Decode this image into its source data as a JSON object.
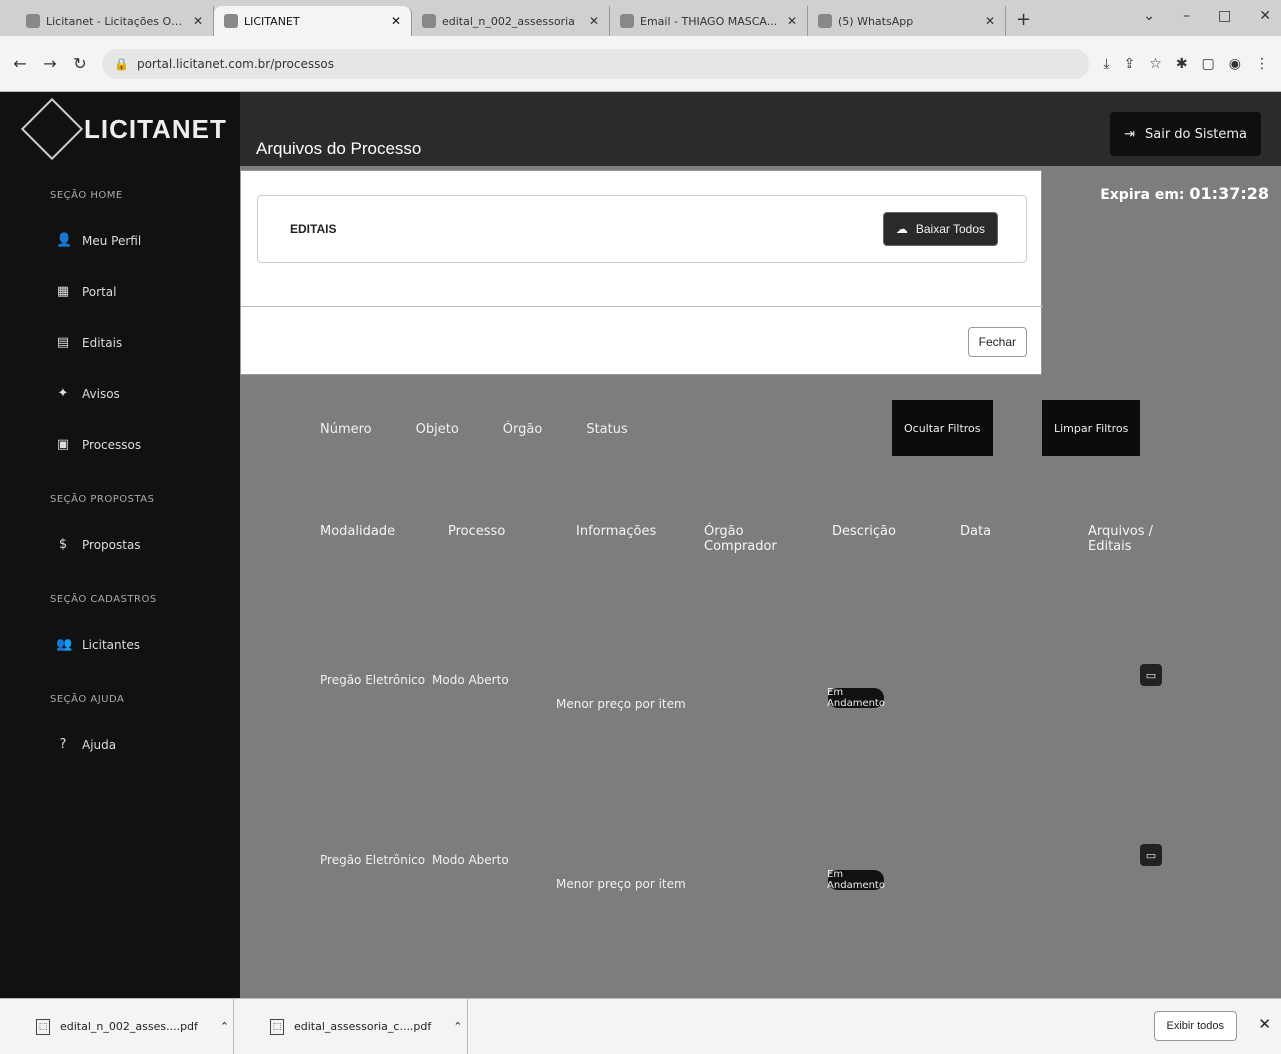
{
  "browser": {
    "tabs": [
      {
        "title": "Licitanet - Licitações On...",
        "active": false
      },
      {
        "title": "LICITANET",
        "active": true
      },
      {
        "title": "edital_n_002_assessoria",
        "active": false
      },
      {
        "title": "Email - THIAGO MASCA...",
        "active": false
      },
      {
        "title": "(5) WhatsApp",
        "active": false
      }
    ],
    "new_tab": "+",
    "url": "portal.licitanet.com.br/processos"
  },
  "sidebar": {
    "brand": "LICITANET",
    "sections": [
      {
        "title": "SEÇÃO HOME",
        "items": [
          "Meu Perfil",
          "Portal",
          "Editais",
          "Avisos",
          "Processos"
        ]
      },
      {
        "title": "SEÇÃO PROPOSTAS",
        "items": [
          "Propostas"
        ]
      },
      {
        "title": "SEÇÃO CADASTROS",
        "items": [
          "Licitantes"
        ]
      },
      {
        "title": "SEÇÃO AJUDA",
        "items": [
          "Ajuda"
        ]
      }
    ]
  },
  "header": {
    "exit_label": "Sair do Sistema",
    "timer_label": "Expira em:",
    "timer_value": "01:37:28"
  },
  "backdrop": {
    "filters": [
      "Número",
      "Objeto",
      "Órgão",
      "Status"
    ],
    "buttons": [
      "Ocultar Filtros",
      "Limpar Filtros"
    ],
    "columns": [
      "Modalidade",
      "Processo",
      "Informações",
      "Órgão Comprador",
      "Descrição",
      "Data",
      "Arquivos / Editais"
    ],
    "rows": [
      {
        "modalidade": "Pregão Eletrônico",
        "processo": "Modo Aberto",
        "info": "Menor preço por item",
        "status": "Em Andamento"
      },
      {
        "modalidade": "Pregão Eletrônico",
        "processo": "Modo Aberto",
        "info": "Menor preço por item",
        "status": "Em Andamento"
      }
    ]
  },
  "modal": {
    "title": "Arquivos do Processo",
    "card_label": "EDITAIS",
    "download_all": "Baixar Todos",
    "close": "Fechar"
  },
  "downloads": {
    "items": [
      "edital_n_002_asses....pdf",
      "edital_assessoria_c....pdf"
    ],
    "show_all": "Exibir todos"
  }
}
